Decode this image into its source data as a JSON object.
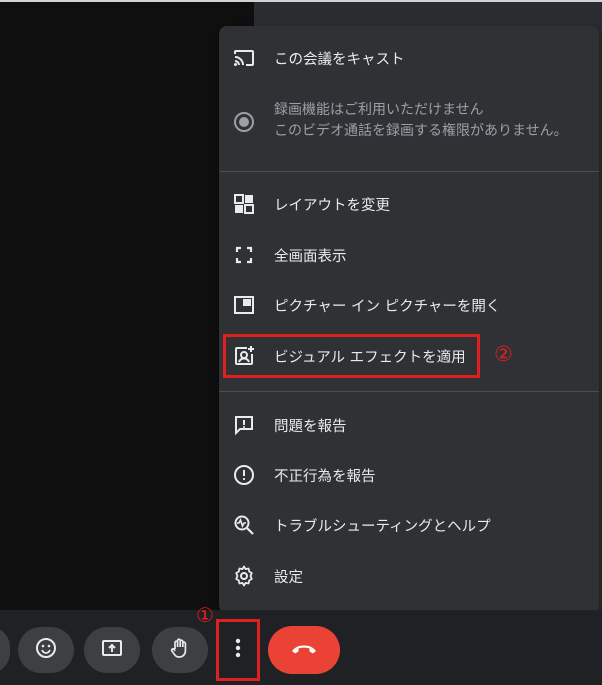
{
  "menu": {
    "cast": {
      "label": "この会議をキャスト",
      "icon": "cast-icon"
    },
    "record": {
      "line1": "録画機能はご利用いただけません",
      "line2": "このビデオ通話を録画する権限がありません。",
      "icon": "record-icon"
    },
    "layout": {
      "label": "レイアウトを変更",
      "icon": "layout-icon"
    },
    "fullscreen": {
      "label": "全画面表示",
      "icon": "fullscreen-icon"
    },
    "pip": {
      "label": "ピクチャー イン ピクチャーを開く",
      "icon": "picture-in-picture-icon"
    },
    "effects": {
      "label": "ビジュアル エフェクトを適用",
      "icon": "visual-effects-icon"
    },
    "report_problem": {
      "label": "問題を報告",
      "icon": "feedback-icon"
    },
    "report_abuse": {
      "label": "不正行為を報告",
      "icon": "report-icon"
    },
    "troubleshoot": {
      "label": "トラブルシューティングとヘルプ",
      "icon": "troubleshoot-icon"
    },
    "settings": {
      "label": "設定",
      "icon": "gear-icon"
    }
  },
  "annotations": {
    "step1": "①",
    "step2": "②",
    "color": "#e02020"
  },
  "toolbar": {
    "buttons": [
      "emoji-icon",
      "present-screen-icon",
      "raise-hand-icon",
      "more-options-icon",
      "end-call-icon"
    ],
    "end_call_color": "#ea4335"
  },
  "colors": {
    "menu_bg": "#303134",
    "text": "#e8eaed",
    "muted_text": "#9aa0a6",
    "toolbar_bg": "#202124"
  }
}
